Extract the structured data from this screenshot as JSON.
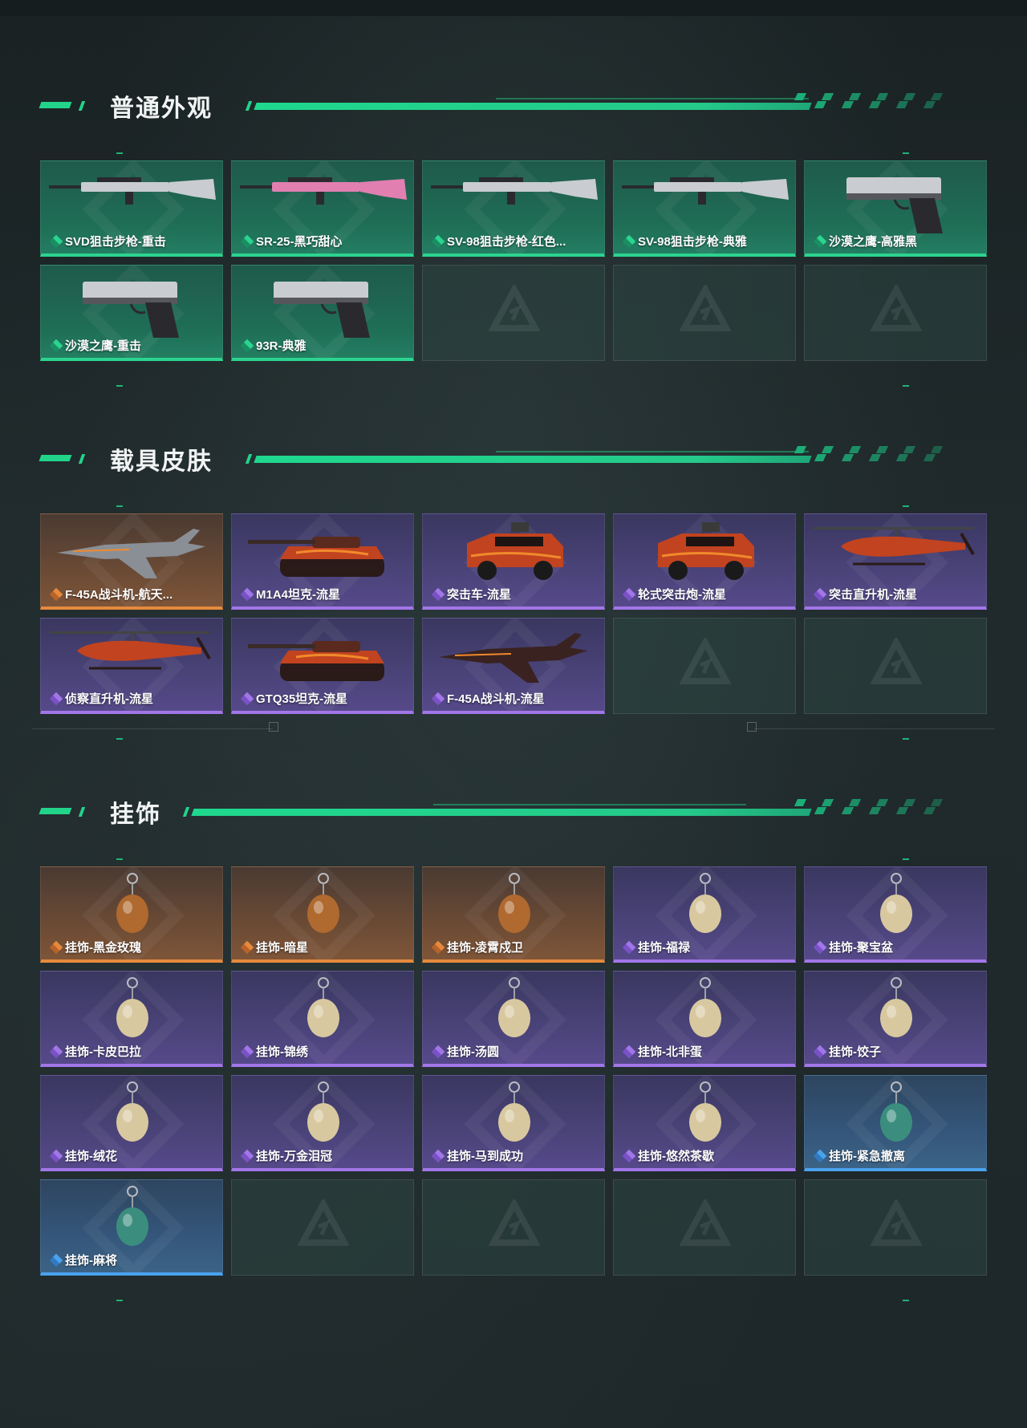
{
  "colors": {
    "accent": "#22d48a",
    "green_rarity": "#2bd48f",
    "orange_rarity": "#e58a3c",
    "purple_rarity": "#a276e8",
    "blue_rarity": "#4aa2ee"
  },
  "sections": [
    {
      "title": "普通外观",
      "items": [
        {
          "label": "SVD狙击步枪-重击",
          "rarity": "green",
          "icon": "sniper-rifle-icon"
        },
        {
          "label": "SR-25-黑巧甜心",
          "rarity": "green",
          "icon": "rifle-icon"
        },
        {
          "label": "SV-98狙击步枪-红色...",
          "rarity": "green",
          "icon": "sniper-rifle-icon"
        },
        {
          "label": "SV-98狙击步枪-典雅",
          "rarity": "green",
          "icon": "sniper-rifle-icon"
        },
        {
          "label": "沙漠之鹰-高雅黑",
          "rarity": "green",
          "icon": "pistol-icon"
        },
        {
          "label": "沙漠之鹰-重击",
          "rarity": "green",
          "icon": "pistol-icon"
        },
        {
          "label": "93R-典雅",
          "rarity": "green",
          "icon": "pistol-icon"
        },
        {
          "label": "",
          "rarity": "empty"
        },
        {
          "label": "",
          "rarity": "empty"
        },
        {
          "label": "",
          "rarity": "empty"
        }
      ]
    },
    {
      "title": "载具皮肤",
      "items": [
        {
          "label": "F-45A战斗机-航天...",
          "rarity": "orange",
          "icon": "fighter-jet-icon"
        },
        {
          "label": "M1A4坦克-流星",
          "rarity": "purple",
          "icon": "tank-icon"
        },
        {
          "label": "突击车-流星",
          "rarity": "purple",
          "icon": "assault-vehicle-icon"
        },
        {
          "label": "轮式突击炮-流星",
          "rarity": "purple",
          "icon": "wheeled-vehicle-icon"
        },
        {
          "label": "突击直升机-流星",
          "rarity": "purple",
          "icon": "helicopter-icon"
        },
        {
          "label": "侦察直升机-流星",
          "rarity": "purple",
          "icon": "helicopter-icon"
        },
        {
          "label": "GTQ35坦克-流星",
          "rarity": "purple",
          "icon": "tank-icon"
        },
        {
          "label": "F-45A战斗机-流星",
          "rarity": "purple",
          "icon": "fighter-jet-icon"
        },
        {
          "label": "",
          "rarity": "empty"
        },
        {
          "label": "",
          "rarity": "empty"
        }
      ]
    },
    {
      "title": "挂饰",
      "items": [
        {
          "label": "挂饰-黑金玫瑰",
          "rarity": "orange",
          "icon": "charm-icon"
        },
        {
          "label": "挂饰-暗星",
          "rarity": "orange",
          "icon": "charm-icon"
        },
        {
          "label": "挂饰-凌霄戍卫",
          "rarity": "orange",
          "icon": "charm-icon"
        },
        {
          "label": "挂饰-福禄",
          "rarity": "purple",
          "icon": "charm-icon"
        },
        {
          "label": "挂饰-聚宝盆",
          "rarity": "purple",
          "icon": "charm-icon"
        },
        {
          "label": "挂饰-卡皮巴拉",
          "rarity": "purple",
          "icon": "charm-icon"
        },
        {
          "label": "挂饰-锦绣",
          "rarity": "purple",
          "icon": "charm-icon"
        },
        {
          "label": "挂饰-汤圆",
          "rarity": "purple",
          "icon": "charm-icon"
        },
        {
          "label": "挂饰-北非蛋",
          "rarity": "purple",
          "icon": "charm-icon"
        },
        {
          "label": "挂饰-饺子",
          "rarity": "purple",
          "icon": "charm-icon"
        },
        {
          "label": "挂饰-绒花",
          "rarity": "purple",
          "icon": "charm-icon"
        },
        {
          "label": "挂饰-万金泪冠",
          "rarity": "purple",
          "icon": "charm-icon"
        },
        {
          "label": "挂饰-马到成功",
          "rarity": "purple",
          "icon": "charm-icon"
        },
        {
          "label": "挂饰-悠然茶歇",
          "rarity": "purple",
          "icon": "charm-icon"
        },
        {
          "label": "挂饰-紧急撤离",
          "rarity": "blue",
          "icon": "charm-icon"
        },
        {
          "label": "挂饰-麻将",
          "rarity": "blue",
          "icon": "charm-icon"
        },
        {
          "label": "",
          "rarity": "empty"
        },
        {
          "label": "",
          "rarity": "empty"
        },
        {
          "label": "",
          "rarity": "empty"
        },
        {
          "label": "",
          "rarity": "empty"
        }
      ]
    }
  ]
}
